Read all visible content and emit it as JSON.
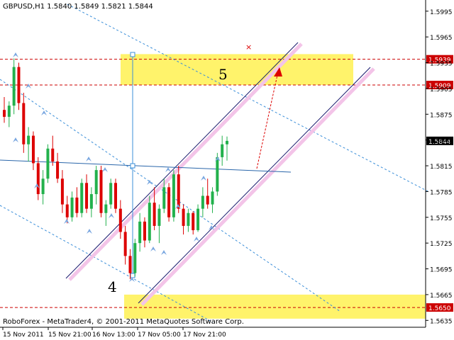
{
  "chart_data": {
    "type": "candlestick",
    "title": "GBPUSD,H1  1.5840 1.5849 1.5821 1.5844",
    "symbol": "GBPUSD,H1",
    "ohlc_header": [
      "1.5840",
      "1.5849",
      "1.5821",
      "1.5844"
    ],
    "footer": "RoboForex - MetaTrader4, © 2001-2011 MetaQuotes Software Corp.",
    "y_range": [
      1.5627,
      1.6008
    ],
    "y_ticks": [
      "1.5995",
      "1.5965",
      "1.5935",
      "1.5905",
      "1.5875",
      "1.5845",
      "1.5815",
      "1.5785",
      "1.5755",
      "1.5725",
      "1.5695",
      "1.5665",
      "1.5635"
    ],
    "x_ticks": [
      "15 Nov 2011",
      "15 Nov 21:00",
      "16 Nov 13:00",
      "17 Nov 05:00",
      "17 Nov 21:00"
    ],
    "levels": [
      {
        "value": 1.5939,
        "label": "1.5939",
        "color": "#cc0000"
      },
      {
        "value": 1.5909,
        "label": "1.5909",
        "color": "#cc0000"
      },
      {
        "value": 1.565,
        "label": "1.5650",
        "color": "#cc0000"
      }
    ],
    "current_price": {
      "value": 1.5844,
      "label": "1.5844"
    },
    "zones": [
      {
        "from": 1.5909,
        "to": 1.5945,
        "color": "#fff36b"
      },
      {
        "from": 1.5637,
        "to": 1.5665,
        "color": "#fff36b"
      }
    ],
    "annotations": [
      "5",
      "4"
    ],
    "colors": {
      "bull": "#22b14c",
      "bear": "#dd0000",
      "channel": "#1a1a6e",
      "dotted": "#3b8fd9",
      "channel_glow": "#f3c4e8",
      "arrow": "#dd0000",
      "level": "#cc0000",
      "zone": "#fff36b"
    },
    "candles": [
      [
        1.588,
        1.5895,
        1.5865,
        1.5872
      ],
      [
        1.5872,
        1.589,
        1.586,
        1.5885
      ],
      [
        1.5885,
        1.594,
        1.5875,
        1.593
      ],
      [
        1.593,
        1.5935,
        1.588,
        1.5888
      ],
      [
        1.5888,
        1.59,
        1.583,
        1.584
      ],
      [
        1.584,
        1.586,
        1.582,
        1.585
      ],
      [
        1.585,
        1.5855,
        1.581,
        1.5818
      ],
      [
        1.5818,
        1.5825,
        1.5775,
        1.5782
      ],
      [
        1.5782,
        1.581,
        1.577,
        1.58
      ],
      [
        1.58,
        1.584,
        1.5795,
        1.5835
      ],
      [
        1.5835,
        1.585,
        1.5815,
        1.582
      ],
      [
        1.582,
        1.583,
        1.5795,
        1.58
      ],
      [
        1.58,
        1.581,
        1.576,
        1.577
      ],
      [
        1.577,
        1.578,
        1.5748,
        1.5755
      ],
      [
        1.5755,
        1.5785,
        1.575,
        1.5778
      ],
      [
        1.5778,
        1.579,
        1.5755,
        1.576
      ],
      [
        1.576,
        1.58,
        1.5755,
        1.5795
      ],
      [
        1.5795,
        1.5805,
        1.576,
        1.5765
      ],
      [
        1.5765,
        1.579,
        1.5755,
        1.5782
      ],
      [
        1.5782,
        1.5815,
        1.577,
        1.581
      ],
      [
        1.581,
        1.5815,
        1.5755,
        1.576
      ],
      [
        1.576,
        1.5775,
        1.5745,
        1.577
      ],
      [
        1.577,
        1.58,
        1.5765,
        1.5795
      ],
      [
        1.5795,
        1.58,
        1.576,
        1.5765
      ],
      [
        1.5765,
        1.5775,
        1.573,
        1.5738
      ],
      [
        1.5738,
        1.5745,
        1.57,
        1.571
      ],
      [
        1.571,
        1.5718,
        1.5683,
        1.569
      ],
      [
        1.569,
        1.573,
        1.5686,
        1.5725
      ],
      [
        1.5725,
        1.576,
        1.5715,
        1.575
      ],
      [
        1.575,
        1.5755,
        1.572,
        1.5728
      ],
      [
        1.5728,
        1.578,
        1.5725,
        1.5772
      ],
      [
        1.5772,
        1.579,
        1.574,
        1.5745
      ],
      [
        1.5745,
        1.577,
        1.5725,
        1.5765
      ],
      [
        1.5765,
        1.58,
        1.576,
        1.579
      ],
      [
        1.579,
        1.5795,
        1.575,
        1.5755
      ],
      [
        1.5755,
        1.581,
        1.575,
        1.5805
      ],
      [
        1.5805,
        1.5815,
        1.576,
        1.5765
      ],
      [
        1.5765,
        1.577,
        1.5735,
        1.5745
      ],
      [
        1.5745,
        1.5765,
        1.5738,
        1.576
      ],
      [
        1.576,
        1.5762,
        1.5735,
        1.574
      ],
      [
        1.574,
        1.577,
        1.5738,
        1.5765
      ],
      [
        1.5765,
        1.579,
        1.5755,
        1.578
      ],
      [
        1.578,
        1.58,
        1.5765,
        1.577
      ],
      [
        1.577,
        1.579,
        1.576,
        1.5785
      ],
      [
        1.5785,
        1.583,
        1.578,
        1.5825
      ],
      [
        1.5825,
        1.585,
        1.5815,
        1.584
      ],
      [
        1.584,
        1.5849,
        1.5821,
        1.5844
      ]
    ]
  }
}
